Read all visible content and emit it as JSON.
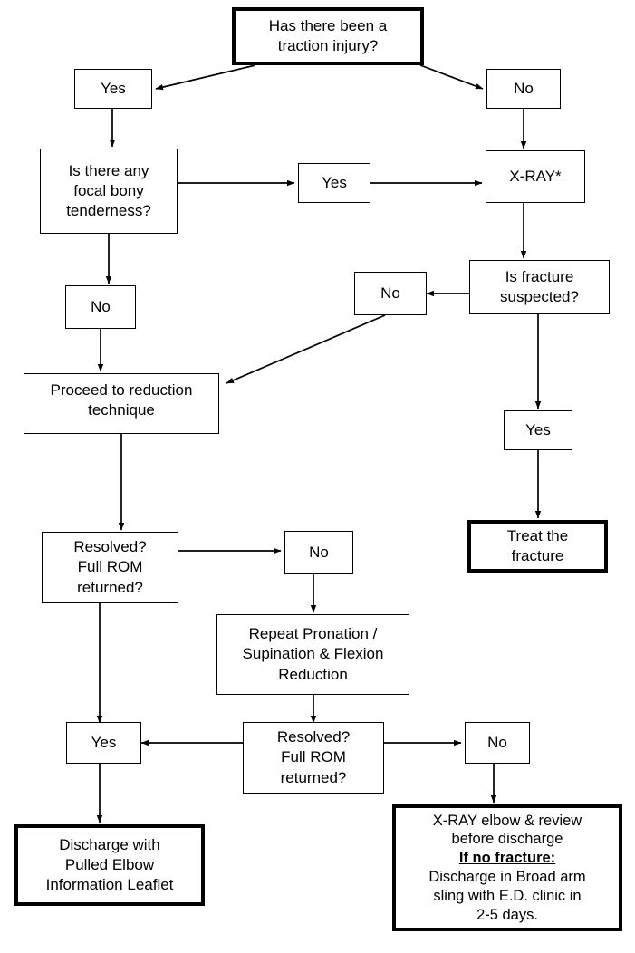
{
  "chart_data": {
    "type": "diagram",
    "title": "Pulled Elbow / Traction Injury Management Flowchart",
    "nodes": [
      {
        "id": "q-traction",
        "label": "Has there been a\ntraction injury?",
        "emphasis": "bold-border"
      },
      {
        "id": "yes-1",
        "label": "Yes",
        "emphasis": "normal"
      },
      {
        "id": "no-1",
        "label": "No",
        "emphasis": "normal"
      },
      {
        "id": "q-tenderness",
        "label": "Is there any\nfocal bony\ntenderness?",
        "emphasis": "normal"
      },
      {
        "id": "yes-2",
        "label": "Yes",
        "emphasis": "normal"
      },
      {
        "id": "xray",
        "label": "X-RAY*",
        "emphasis": "normal"
      },
      {
        "id": "no-2",
        "label": "No",
        "emphasis": "normal"
      },
      {
        "id": "q-fracture",
        "label": "Is fracture\nsuspected?",
        "emphasis": "normal"
      },
      {
        "id": "no-3",
        "label": "No",
        "emphasis": "normal"
      },
      {
        "id": "yes-3",
        "label": "Yes",
        "emphasis": "normal"
      },
      {
        "id": "proceed",
        "label": "Proceed to reduction\ntechnique",
        "emphasis": "normal"
      },
      {
        "id": "treat",
        "label": "Treat the\nfracture",
        "emphasis": "bold-border"
      },
      {
        "id": "q-resolved-1",
        "label": "Resolved?\nFull ROM\nreturned?",
        "emphasis": "normal"
      },
      {
        "id": "no-4",
        "label": "No",
        "emphasis": "normal"
      },
      {
        "id": "repeat",
        "label": "Repeat Pronation /\nSupination & Flexion\nReduction",
        "emphasis": "normal"
      },
      {
        "id": "yes-4",
        "label": "Yes",
        "emphasis": "normal"
      },
      {
        "id": "q-resolved-2",
        "label": "Resolved?\nFull ROM\nreturned?",
        "emphasis": "normal"
      },
      {
        "id": "no-5",
        "label": "No",
        "emphasis": "normal"
      },
      {
        "id": "discharge",
        "label": "Discharge with\nPulled Elbow\nInformation Leaflet",
        "emphasis": "bold-border"
      },
      {
        "id": "xray-review",
        "label_part1": "X-RAY elbow & review\nbefore discharge",
        "label_emph": "If no fracture:",
        "label_part2": "Discharge in Broad arm\nsling with E.D. clinic in\n2-5 days.",
        "emphasis": "bold-border"
      }
    ],
    "edges": [
      {
        "from": "q-traction",
        "to": "yes-1",
        "style": "diagonal"
      },
      {
        "from": "q-traction",
        "to": "no-1",
        "style": "diagonal"
      },
      {
        "from": "yes-1",
        "to": "q-tenderness",
        "style": "straight"
      },
      {
        "from": "no-1",
        "to": "xray",
        "style": "straight"
      },
      {
        "from": "q-tenderness",
        "to": "yes-2",
        "style": "straight"
      },
      {
        "from": "yes-2",
        "to": "xray",
        "style": "straight"
      },
      {
        "from": "q-tenderness",
        "to": "no-2",
        "style": "straight"
      },
      {
        "from": "no-2",
        "to": "proceed",
        "style": "straight"
      },
      {
        "from": "xray",
        "to": "q-fracture",
        "style": "straight"
      },
      {
        "from": "q-fracture",
        "to": "no-3",
        "style": "straight"
      },
      {
        "from": "no-3",
        "to": "proceed",
        "style": "diagonal"
      },
      {
        "from": "q-fracture",
        "to": "yes-3",
        "style": "straight"
      },
      {
        "from": "yes-3",
        "to": "treat",
        "style": "straight"
      },
      {
        "from": "proceed",
        "to": "q-resolved-1",
        "style": "straight"
      },
      {
        "from": "q-resolved-1",
        "to": "no-4",
        "style": "straight"
      },
      {
        "from": "no-4",
        "to": "repeat",
        "style": "straight"
      },
      {
        "from": "repeat",
        "to": "q-resolved-2",
        "style": "straight"
      },
      {
        "from": "q-resolved-1",
        "to": "yes-4",
        "style": "straight"
      },
      {
        "from": "q-resolved-2",
        "to": "yes-4",
        "style": "straight"
      },
      {
        "from": "q-resolved-2",
        "to": "no-5",
        "style": "straight"
      },
      {
        "from": "yes-4",
        "to": "discharge",
        "style": "straight"
      },
      {
        "from": "no-5",
        "to": "xray-review",
        "style": "straight"
      }
    ],
    "colors": {
      "box_border": "#000000",
      "box_fill": "#ffffff",
      "text": "#000000",
      "connector": "#000000",
      "background": "#ffffff"
    }
  },
  "nodes": {
    "q_traction": "Has there been a\ntraction injury?",
    "yes_1": "Yes",
    "no_1": "No",
    "q_tenderness": "Is there any\nfocal bony\ntenderness?",
    "yes_2": "Yes",
    "xray": "X-RAY*",
    "no_2": "No",
    "q_fracture": "Is fracture\nsuspected?",
    "no_3": "No",
    "yes_3": "Yes",
    "proceed": "Proceed to reduction\ntechnique",
    "treat": "Treat the\nfracture",
    "q_resolved_1": "Resolved?\nFull ROM\nreturned?",
    "no_4": "No",
    "repeat": "Repeat Pronation /\nSupination & Flexion\nReduction",
    "yes_4": "Yes",
    "q_resolved_2": "Resolved?\nFull ROM\nreturned?",
    "no_5": "No",
    "discharge": "Discharge with\nPulled Elbow\nInformation Leaflet",
    "xray_review_line1": "X-RAY elbow & review\nbefore discharge",
    "xray_review_emph": "If no fracture:",
    "xray_review_line2": "Discharge in Broad arm\nsling with E.D. clinic in\n2-5 days."
  }
}
